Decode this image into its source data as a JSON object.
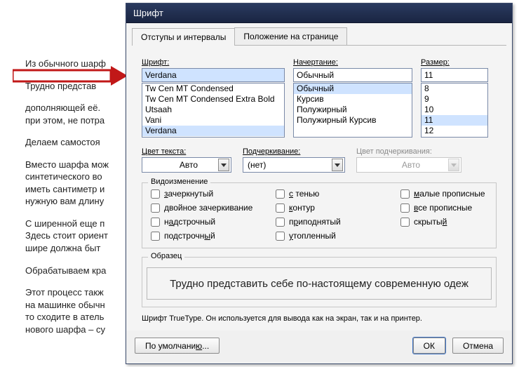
{
  "bg_paragraphs": [
    "Из обычного шарф",
    "Трудно представ",
    "дополняющей её.",
    "при этом, не потра",
    "Делаем самостоя",
    "Вместо шарфа мож",
    "синтетического во",
    "иметь сантиметр и",
    "нужную вам длину",
    " С ширенной еще п",
    "Здесь стоит ориент",
    "шире должна быт",
    "Обрабатываем кра",
    "Этот процесс такж",
    "на машинке обычн",
    "то сходите в атель",
    "нового шарфа – су"
  ],
  "dialog": {
    "title": "Шрифт"
  },
  "tabs": {
    "t1": "Отступы и интервалы",
    "t2": "Положение на странице"
  },
  "font": {
    "label": "Шрифт:",
    "value": "Verdana",
    "options": [
      "Tw Cen MT Condensed",
      "Tw Cen MT Condensed Extra Bold",
      "Utsaah",
      "Vani",
      "Verdana"
    ]
  },
  "style": {
    "label": "Начертание:",
    "value": "Обычный",
    "options": [
      "Обычный",
      "Курсив",
      "Полужирный",
      "Полужирный Курсив"
    ]
  },
  "size": {
    "label": "Размер:",
    "value": "11",
    "options": [
      "8",
      "9",
      "10",
      "11",
      "12"
    ]
  },
  "color": {
    "label": "Цвет текста:",
    "value": "Авто"
  },
  "underline_style": {
    "label": "Подчеркивание:",
    "value": "(нет)"
  },
  "underline_color": {
    "label": "Цвет подчеркивания:",
    "value": "Авто"
  },
  "effects_title": "Видоизменение",
  "effects": {
    "c1": [
      "зачеркнутый",
      "двойное зачеркивание",
      "надстрочный",
      "подстрочный"
    ],
    "c2": [
      "с тенью",
      "контур",
      "приподнятый",
      "утопленный"
    ],
    "c3": [
      "малые прописные",
      "все прописные",
      "скрытый"
    ]
  },
  "sample": {
    "label": "Образец",
    "text": "Трудно представить себе по-настоящему современную одеж"
  },
  "infotext": "Шрифт TrueType. Он используется для вывода как на экран, так и на принтер.",
  "buttons": {
    "default": "По умолчанию...",
    "ok": "ОК",
    "cancel": "Отмена"
  }
}
